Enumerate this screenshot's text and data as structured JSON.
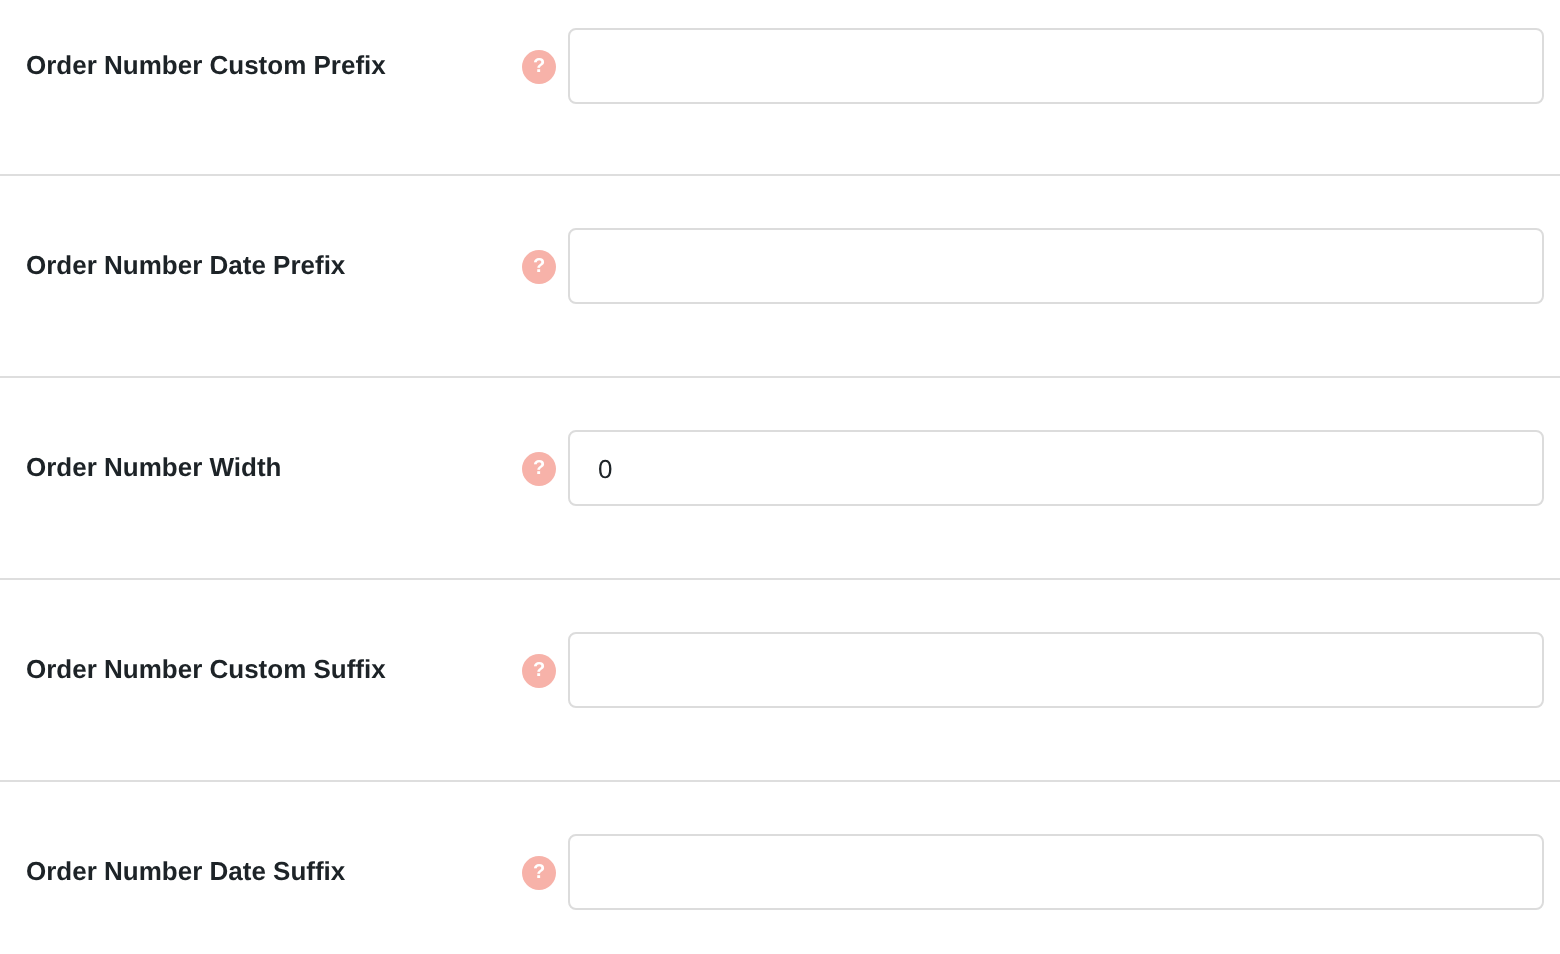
{
  "fields": [
    {
      "label": "Order Number Custom Prefix",
      "help": "?"
    },
    {
      "label": "Order Number Date Prefix",
      "help": "?"
    },
    {
      "label": "Order Number Width",
      "help": "?",
      "value": "0"
    },
    {
      "label": "Order Number Custom Suffix",
      "help": "?"
    },
    {
      "label": "Order Number Date Suffix",
      "help": "?"
    }
  ]
}
